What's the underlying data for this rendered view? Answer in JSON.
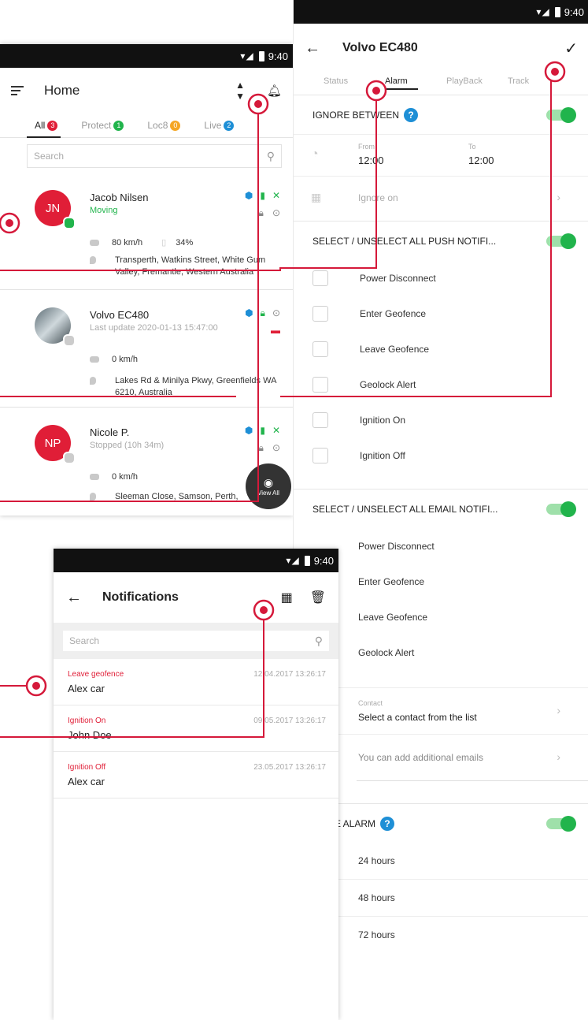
{
  "status": {
    "time": "9:40"
  },
  "home": {
    "title": "Home",
    "tabs": [
      {
        "label": "All",
        "count": "3",
        "color": "#e01e37"
      },
      {
        "label": "Protect",
        "count": "1",
        "color": "#21b44c"
      },
      {
        "label": "Loc8",
        "count": "0",
        "color": "#f5a623"
      },
      {
        "label": "Live",
        "count": "2",
        "color": "#1e8fd6"
      }
    ],
    "search_placeholder": "Search",
    "vehicles": [
      {
        "initials": "JN",
        "name": "Jacob Nilsen",
        "status": "Moving",
        "status_color": "#21b44c",
        "dot_color": "#21b44c",
        "speed": "80 km/h",
        "battery": "34%",
        "address": "Transperth, Watkins Street, White Gum Valley, Fremantle, Western Australia"
      },
      {
        "initials": "",
        "name": "Volvo EC480",
        "status": "Last update 2020-01-13 15:47:00",
        "status_color": "#aaaaaa",
        "dot_color": "#cccccc",
        "speed": "0 km/h",
        "battery": "",
        "address": "Lakes Rd & Minilya Pkwy, Greenfields WA 6210, Australia"
      },
      {
        "initials": "NP",
        "name": "Nicole P.",
        "status": "Stopped (10h 34m)",
        "status_color": "#aaaaaa",
        "dot_color": "#cccccc",
        "speed": "0 km/h",
        "battery": "",
        "address": "Sleeman Close, Samson, Perth,"
      }
    ],
    "view_all": "View All"
  },
  "alarm": {
    "title": "Volvo EC480",
    "tabs": [
      "Status",
      "Alarm",
      "PlayBack",
      "Track"
    ],
    "ignore_between": "IGNORE BETWEEN",
    "from_label": "From",
    "from_value": "12:00",
    "to_label": "To",
    "to_value": "12:00",
    "ignore_on": "Ignore on",
    "push_all": "SELECT / UNSELECT ALL PUSH NOTIFI...",
    "push_items": [
      "Power Disconnect",
      "Enter Geofence",
      "Leave Geofence",
      "Geolock Alert",
      "Ignition On",
      "Ignition Off"
    ],
    "email_all": "SELECT / UNSELECT ALL EMAIL NOTIFI...",
    "email_items": [
      "Power Disconnect",
      "Enter Geofence",
      "Leave Geofence",
      "Geolock Alert"
    ],
    "contact_label": "Contact",
    "contact_value": "Select a contact from the list",
    "additional_emails": "You can add additional emails",
    "engine_alarm": "INE ALARM",
    "hours": [
      "24 hours",
      "48 hours",
      "72 hours"
    ]
  },
  "notifications": {
    "title": "Notifications",
    "search_placeholder": "Search",
    "items": [
      {
        "type": "Leave geofence",
        "name": "Alex car",
        "date": "12.04.2017  13:26:17"
      },
      {
        "type": "Ignition On",
        "name": "John Doe",
        "date": "09.05.2017  13:26:17"
      },
      {
        "type": "Ignition Off",
        "name": "Alex car",
        "date": "23.05.2017  13:26:17"
      }
    ]
  },
  "colors": {
    "accent_red": "#e01e37",
    "green": "#21b44c",
    "blue": "#1e8fd6"
  }
}
